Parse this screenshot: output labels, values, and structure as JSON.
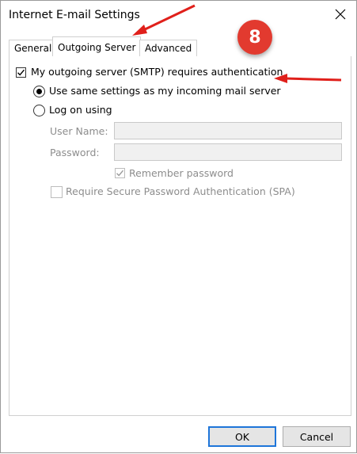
{
  "window": {
    "title": "Internet E-mail Settings"
  },
  "tabs": [
    {
      "label": "General",
      "active": false
    },
    {
      "label": "Outgoing Server",
      "active": true
    },
    {
      "label": "Advanced",
      "active": false
    }
  ],
  "smtp": {
    "requires_auth_label": "My outgoing server (SMTP) requires authentication",
    "checked": true
  },
  "auth_options": {
    "same_settings_label": "Use same settings as my incoming mail server",
    "logon_label": "Log on using",
    "selected": "same_settings"
  },
  "credentials": {
    "username_label": "User Name:",
    "username_value": "",
    "password_label": "Password:",
    "password_value": "",
    "remember_label": "Remember password",
    "remember_checked": true,
    "spa_label": "Require Secure Password Authentication (SPA)",
    "spa_checked": false
  },
  "buttons": {
    "ok": "OK",
    "cancel": "Cancel"
  },
  "annotation": {
    "step_number": "8",
    "badge_color": "#e23a2f",
    "arrow_color": "#e0201b"
  }
}
